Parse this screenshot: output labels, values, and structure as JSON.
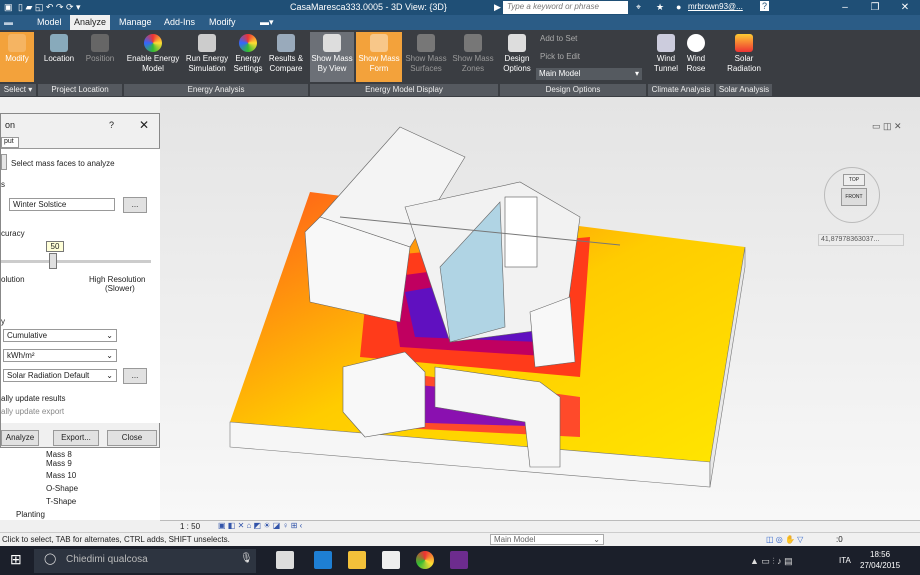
{
  "titlebar": {
    "title": "CasaMaresca333.0005 - 3D View: {3D}",
    "search_placeholder": "Type a keyword or phrase",
    "user": "mrbrown93@...",
    "help": "?"
  },
  "menubar": {
    "items": [
      "Model",
      "Analyze",
      "Manage",
      "Add-Ins",
      "Modify"
    ],
    "active": "Analyze"
  },
  "ribbon": {
    "buttons": [
      "Modify",
      "Location",
      "Position",
      "Enable Energy Model",
      "Run Energy Simulation",
      "Energy Settings",
      "Results & Compare",
      "Show Mass By View",
      "Show Mass Form",
      "Show Mass Surfaces",
      "Show Mass Zones",
      "Design Options",
      "Add to Set",
      "Pick to Edit",
      "Main Model",
      "Wind Tunnel",
      "Wind Rose",
      "Solar Radiation"
    ],
    "groups": [
      "Select",
      "Project Location",
      "Energy Analysis",
      "Energy Model Display",
      "Design Options",
      "Climate Analysis",
      "Solar Analysis"
    ]
  },
  "dialog": {
    "title": "on",
    "help": "?",
    "close": "✕",
    "tab": "put",
    "select_faces": "Select mass faces to analyze",
    "section_dates": "s",
    "solstice": "Winter Solstice",
    "browse": "...",
    "section_accuracy": "curacy",
    "accuracy_value": "50",
    "res_low": "olution",
    "res_high_1": "High Resolution",
    "res_high_2": "(Slower)",
    "section_display": "y",
    "type": "Cumulative",
    "unit": "kWh/m²",
    "style": "Solar Radiation Default",
    "style_browse": "...",
    "update_results": "ally update results",
    "update_export": "ally update export",
    "analyze": "Analyze",
    "export": "Export...",
    "close_btn": "Close"
  },
  "tree": {
    "items": [
      "Mass 8",
      "Mass 9",
      "Mass 10",
      "O-Shape",
      "T-Shape",
      "Planting"
    ]
  },
  "viewcube": {
    "top": "TOP",
    "front": "FRONT",
    "coords": "41,87978363037..."
  },
  "view_controls": {
    "scale": "1 : 50"
  },
  "status": {
    "hint": "Click to select, TAB for alternates, CTRL adds, SHIFT unselects.",
    "model": "Main Model",
    "zero": ":0"
  },
  "taskbar": {
    "search": "Chiedimi qualcosa",
    "time": "18:56",
    "date": "27/04/2015",
    "lang": "ITA"
  }
}
